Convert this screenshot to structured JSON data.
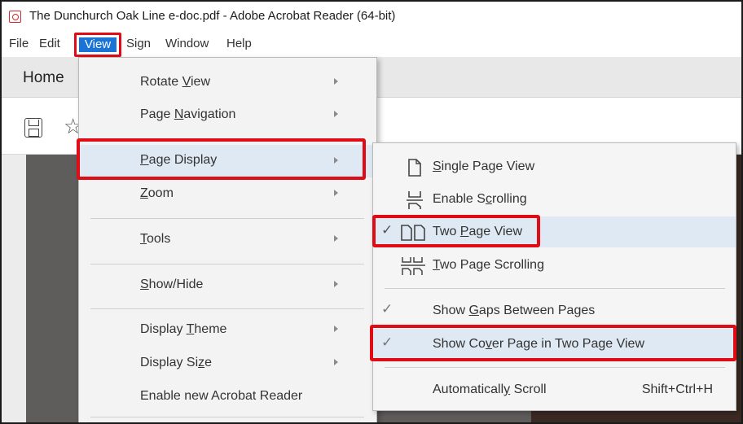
{
  "window": {
    "title": "The Dunchurch Oak Line e-doc.pdf - Adobe Acrobat Reader (64-bit)"
  },
  "menubar": {
    "items": [
      "File",
      "Edit",
      "View",
      "Sign",
      "Window",
      "Help"
    ]
  },
  "tabs": {
    "home": "Home"
  },
  "view_menu": {
    "rotate_view": {
      "pre": "Rotate ",
      "u": "V",
      "post": "iew"
    },
    "page_navigation": {
      "pre": "Page ",
      "u": "N",
      "post": "avigation"
    },
    "page_display": {
      "pre": "",
      "u": "P",
      "post": "age Display"
    },
    "zoom": {
      "pre": "",
      "u": "Z",
      "post": "oom"
    },
    "tools": {
      "pre": "",
      "u": "T",
      "post": "ools"
    },
    "show_hide": {
      "pre": "",
      "u": "S",
      "post": "how/Hide"
    },
    "display_theme": {
      "pre": "Display ",
      "u": "T",
      "post": "heme"
    },
    "display_size": {
      "pre": "Display Si",
      "u": "z",
      "post": "e"
    },
    "enable_new": "Enable new Acrobat Reader"
  },
  "page_display_menu": {
    "single_page_view": {
      "pre": "",
      "u": "S",
      "post": "ingle Page View"
    },
    "enable_scrolling": {
      "pre": "Enable S",
      "u": "c",
      "post": "rolling"
    },
    "two_page_view": {
      "pre": "Two ",
      "u": "P",
      "post": "age View"
    },
    "two_page_scrolling": {
      "pre": "",
      "u": "T",
      "post": "wo Page Scrolling"
    },
    "show_gaps": {
      "pre": "Show ",
      "u": "G",
      "post": "aps Between Pages"
    },
    "show_cover": {
      "pre": "Show Co",
      "u": "v",
      "post": "er Page in Two Page View"
    },
    "auto_scroll": {
      "pre": "Automaticall",
      "u": "y",
      "post": " Scroll"
    },
    "auto_scroll_shortcut": "Shift+Ctrl+H",
    "checkmark": "✓"
  },
  "colors": {
    "highlight_box": "#e00b14",
    "selected_menu": "#1a73d6",
    "menu_bg": "#f3f3f3",
    "hover_bg": "#dfe9f3"
  }
}
